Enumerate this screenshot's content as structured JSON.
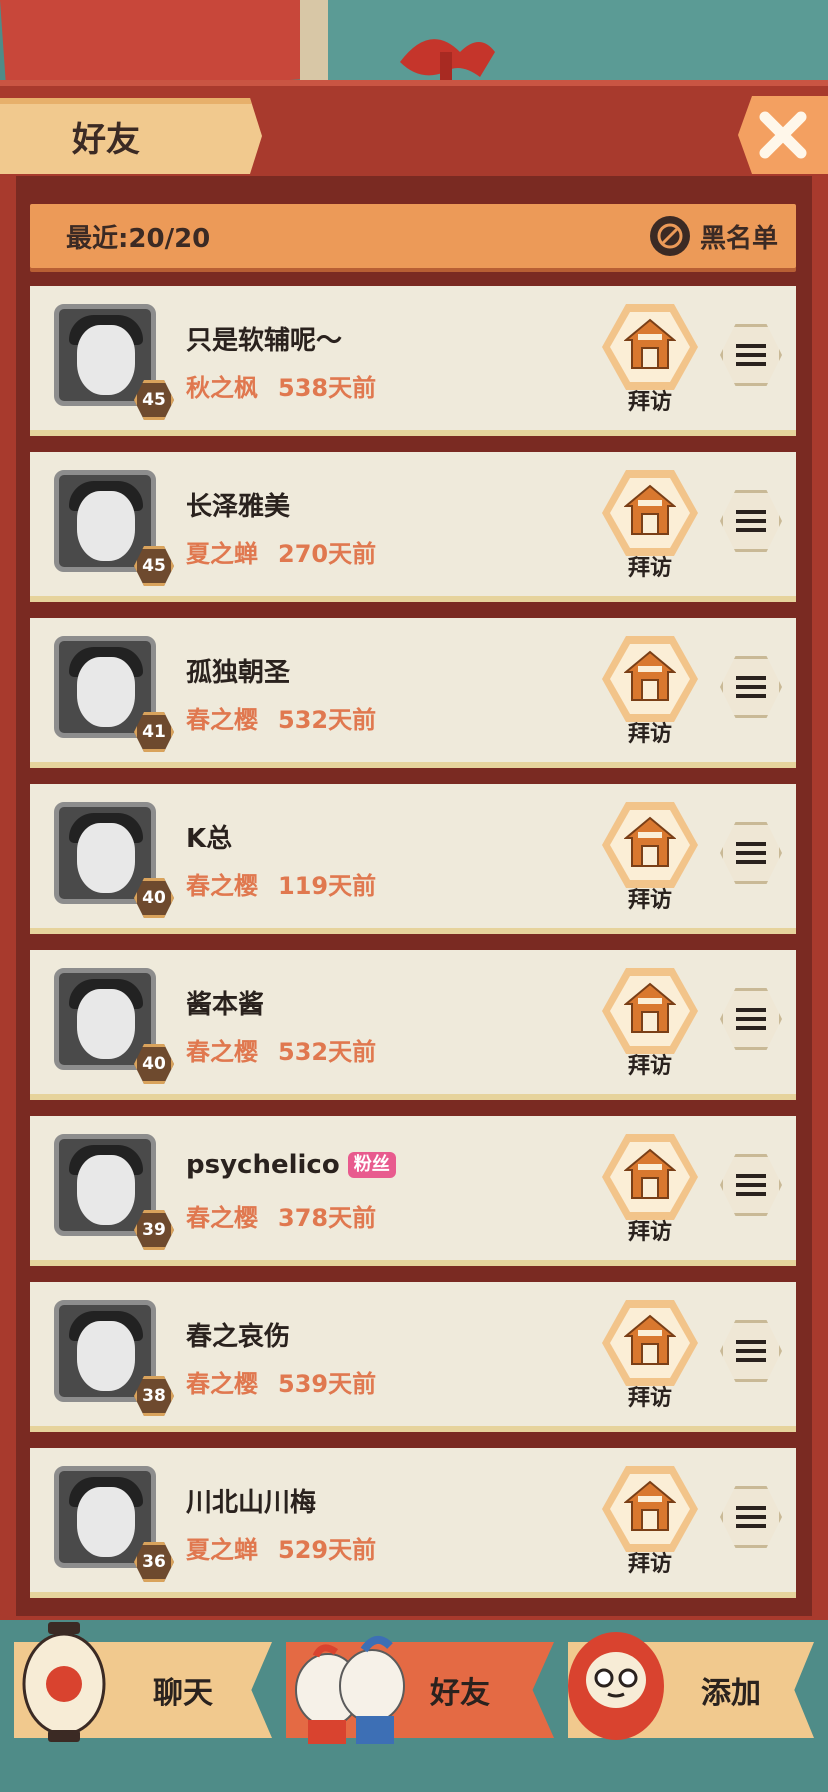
{
  "header": {
    "title": "好友",
    "recent_label": "最近:20/20",
    "blacklist_label": "黑名单"
  },
  "friends": [
    {
      "name": "只是软辅呢～",
      "season": "秋之枫",
      "last_seen": "538天前",
      "level": "45",
      "fan": ""
    },
    {
      "name": "长泽雅美",
      "season": "夏之蝉",
      "last_seen": "270天前",
      "level": "45",
      "fan": ""
    },
    {
      "name": "孤独朝圣",
      "season": "春之樱",
      "last_seen": "532天前",
      "level": "41",
      "fan": ""
    },
    {
      "name": "K总",
      "season": "春之樱",
      "last_seen": "119天前",
      "level": "40",
      "fan": ""
    },
    {
      "name": "酱本酱",
      "season": "春之樱",
      "last_seen": "532天前",
      "level": "40",
      "fan": ""
    },
    {
      "name": "psychelico",
      "season": "春之樱",
      "last_seen": "378天前",
      "level": "39",
      "fan": "粉丝"
    },
    {
      "name": "春之哀伤",
      "season": "春之樱",
      "last_seen": "539天前",
      "level": "38",
      "fan": ""
    },
    {
      "name": "川北山川梅",
      "season": "夏之蝉",
      "last_seen": "529天前",
      "level": "36",
      "fan": ""
    }
  ],
  "visit_label": "拜访",
  "tabs": {
    "chat": "聊天",
    "friends": "好友",
    "add": "添加"
  },
  "icons": {
    "close": "close-icon",
    "blacklist": "block-icon",
    "visit": "house-icon",
    "menu": "hamburger-icon",
    "chat_tab": "lantern-icon",
    "friends_tab": "friends-duo-icon",
    "add_tab": "daruma-icon"
  },
  "colors": {
    "board": "#a83a2d",
    "tab_bg": "#f1c98e",
    "active_tab": "#e46a44",
    "meta_text": "#e0784f",
    "row_bg": "#efeadb",
    "fan_badge": "#e85b8e"
  }
}
